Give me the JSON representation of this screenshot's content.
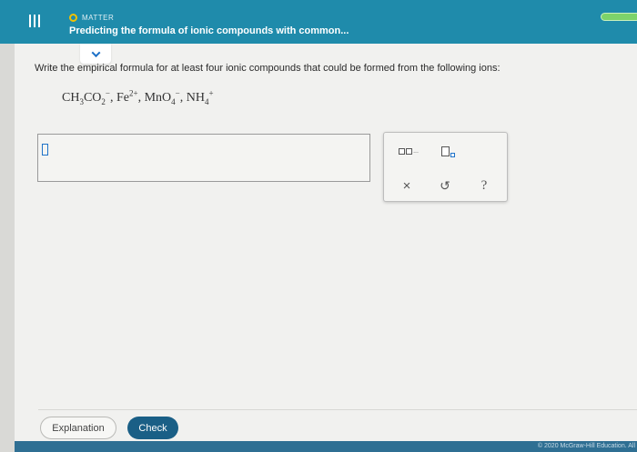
{
  "header": {
    "topic": "MATTER",
    "title": "Predicting the formula of ionic compounds with common..."
  },
  "question": {
    "prompt": "Write the empirical formula for at least four ionic compounds that could be formed from the following ions:",
    "ions": [
      {
        "base": "CH",
        "sub1": "3",
        "mid": "CO",
        "sub2": "2",
        "charge": "−"
      },
      {
        "base": "Fe",
        "charge": "2+"
      },
      {
        "base": "MnO",
        "sub1": "4",
        "charge": "−"
      },
      {
        "base": "NH",
        "sub1": "4",
        "charge": "+"
      }
    ],
    "answer_value": ""
  },
  "tools": {
    "dots_text": "...",
    "clear_symbol": "×",
    "undo_symbol": "↺",
    "help_symbol": "?"
  },
  "footer": {
    "explanation_label": "Explanation",
    "check_label": "Check",
    "copyright": "© 2020 McGraw-Hill Education. All"
  },
  "colors": {
    "header_bg": "#1f8bab",
    "check_bg": "#1a5f86",
    "accent": "#1f72c8",
    "progress": "#7dd36a"
  }
}
